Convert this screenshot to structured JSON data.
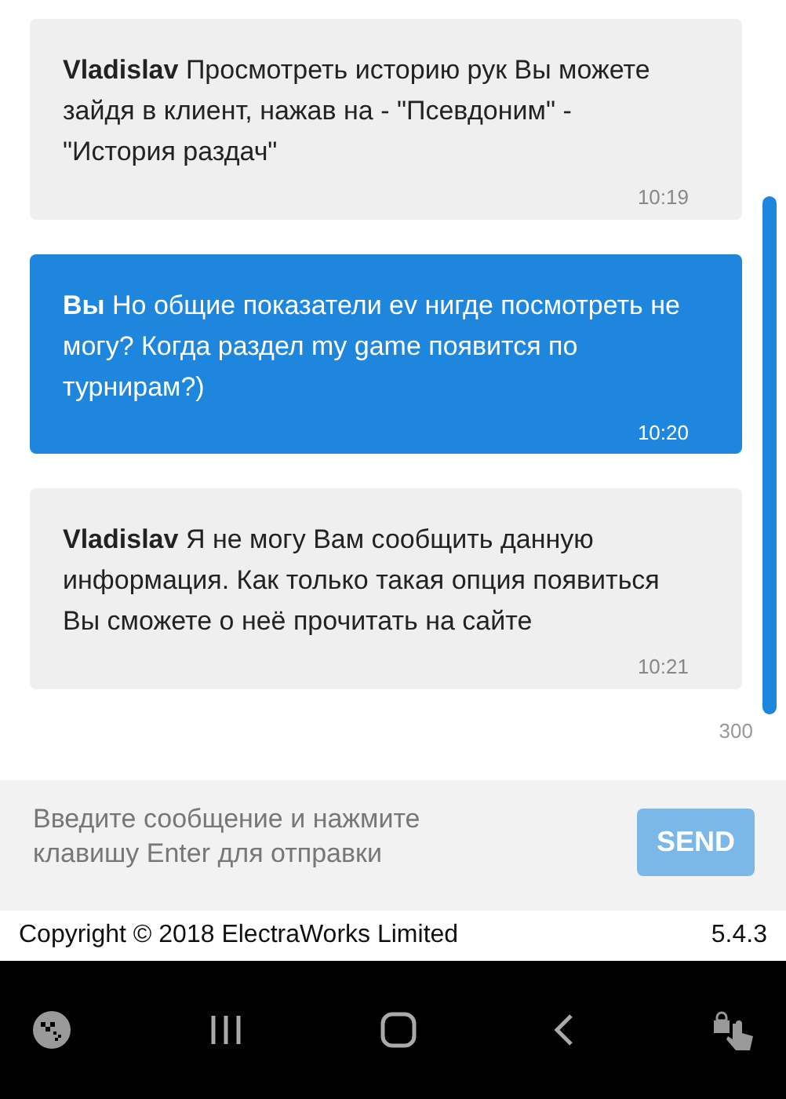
{
  "messages": [
    {
      "sender": "Vladislav",
      "text": "Просмотреть историю рук Вы можете зайдя в клиент, нажав на - \"Псевдоним\" - \"История раздач\"",
      "time": "10:19",
      "own": false
    },
    {
      "sender": "Вы",
      "text": "Но общие показатели ev нигде посмотреть не могу? Когда раздел my game появится по турнирам?)",
      "time": "10:20",
      "own": true
    },
    {
      "sender": "Vladislav",
      "text": "Я не могу Вам сообщить данную информация. Как только такая опция появиться Вы сможете о неё прочитать на сайте",
      "time": "10:21",
      "own": false
    }
  ],
  "char_counter": "300",
  "composer": {
    "placeholder": "Введите сообщение и нажмите клавишу Enter для отправки",
    "send_label": "SEND",
    "send_disabled": true
  },
  "footer": {
    "copyright": "Copyright © 2018 ElectraWorks Limited",
    "version": "5.4.3"
  }
}
